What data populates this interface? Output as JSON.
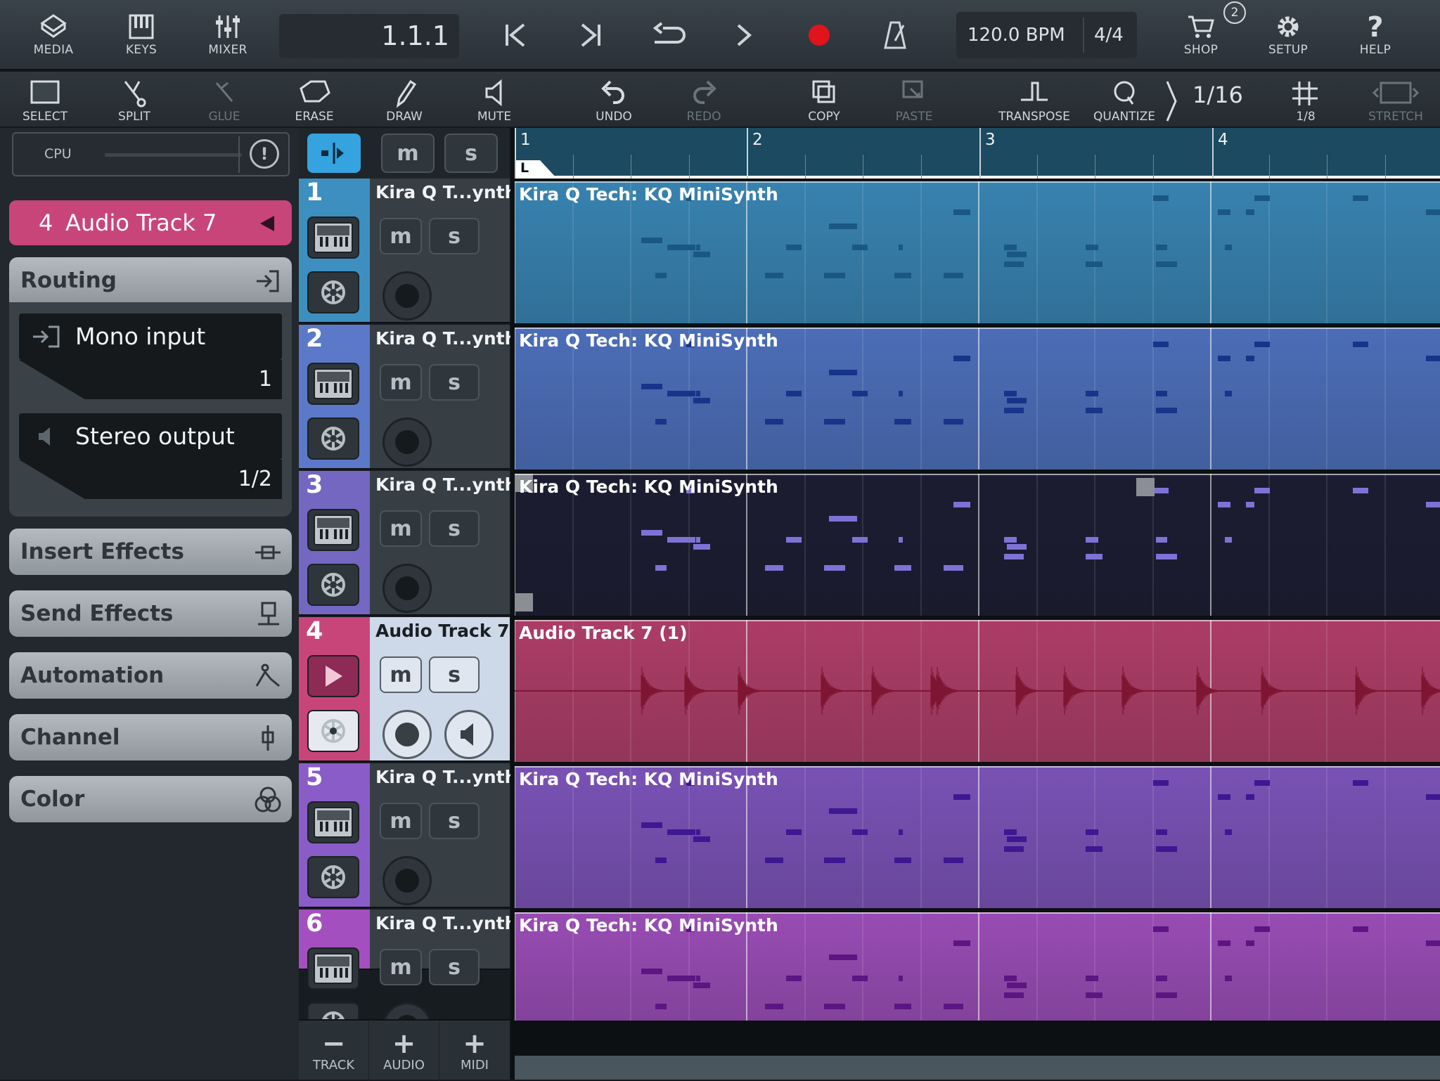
{
  "top_nav": {
    "media": "MEDIA",
    "keys": "KEYS",
    "mixer": "MIXER",
    "position": "1.1.1",
    "tempo": "120.0 BPM",
    "signature": "4/4",
    "shop": "SHOP",
    "shop_badge": "2",
    "setup": "SETUP",
    "help": "HELP"
  },
  "tools": {
    "select": "SELECT",
    "split": "SPLIT",
    "glue": "GLUE",
    "erase": "ERASE",
    "draw": "DRAW",
    "mute": "MUTE",
    "undo": "UNDO",
    "redo": "REDO",
    "copy": "COPY",
    "paste": "PASTE",
    "transpose": "TRANSPOSE",
    "quantize": "QUANTIZE",
    "quantize_value": "1/16",
    "grid": "1/8",
    "stretch": "STRETCH"
  },
  "inspector": {
    "cpu_label": "CPU",
    "selected_track_number": "4",
    "selected_track_name": "Audio Track 7",
    "routing_label": "Routing",
    "input_label": "Mono input",
    "input_channel": "1",
    "output_label": "Stereo output",
    "output_channel": "1/2",
    "sections": [
      "Insert Effects",
      "Send Effects",
      "Automation",
      "Channel",
      "Color"
    ]
  },
  "tracks": [
    {
      "number": "1",
      "name": "Kira Q T...ynth",
      "clip": "Kira Q Tech: KQ MiniSynth",
      "color": "#3d8fc0",
      "lane_color": "#3a88b8",
      "note_color": "#1a5784"
    },
    {
      "number": "2",
      "name": "Kira Q T...ynth",
      "clip": "Kira Q Tech: KQ MiniSynth",
      "color": "#5b79c8",
      "lane_color": "#4f72c0",
      "note_color": "#18348a"
    },
    {
      "number": "3",
      "name": "Kira Q T...ynth",
      "clip": "Kira Q Tech: KQ MiniSynth",
      "color": "#7467c2",
      "lane_color": "#1d1d33",
      "note_color": "#7f72d6"
    },
    {
      "number": "4",
      "name": "Audio Track 7",
      "clip": "Audio Track 7 (1)",
      "color": "#c8457a",
      "lane_color": "#b43f6a",
      "note_color": "#7e1633"
    },
    {
      "number": "5",
      "name": "Kira Q T...ynth",
      "clip": "Kira Q Tech: KQ MiniSynth",
      "color": "#8a5cc8",
      "lane_color": "#7f55bd",
      "note_color": "#3e1792"
    },
    {
      "number": "6",
      "name": "Kira Q T...ynth",
      "clip": "Kira Q Tech: KQ MiniSynth",
      "color": "#a44fc0",
      "lane_color": "#a04fbc",
      "note_color": "#5c1582"
    }
  ],
  "track_buttons": {
    "mute": "m",
    "solo": "s"
  },
  "bottom_buttons": {
    "track": "TRACK",
    "audio": "AUDIO",
    "midi": "MIDI"
  },
  "ruler": {
    "bars": [
      "1",
      "2",
      "3",
      "4"
    ],
    "locator": "L"
  }
}
